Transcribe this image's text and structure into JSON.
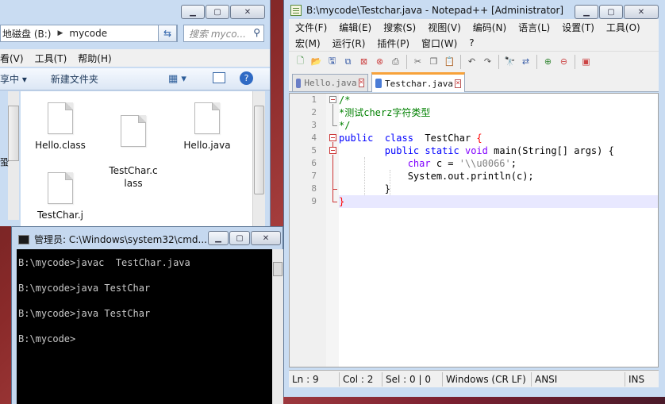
{
  "explorer": {
    "address": {
      "drive": "地磁盘 (B:)",
      "folder": "mycode"
    },
    "search_placeholder": "搜索 myco...",
    "menu": [
      "看(V)",
      "工具(T)",
      "帮助(H)"
    ],
    "toolbar": {
      "organize": "享中 ▾",
      "new_folder": "新建文件夹"
    },
    "files": [
      {
        "name": "Hello.class"
      },
      {
        "name": "TestChar.c\nlass"
      },
      {
        "name": "Hello.java"
      },
      {
        "name": "TestChar.j"
      }
    ],
    "side_text": "蛩"
  },
  "cmd": {
    "title": "管理员: C:\\Windows\\system32\\cmd....",
    "lines": [
      "B:\\mycode>javac  TestChar.java",
      "B:\\mycode>java TestChar",
      "B:\\mycode>java TestChar",
      "B:\\mycode>"
    ]
  },
  "npp": {
    "title": "B:\\mycode\\Testchar.java - Notepad++ [Administrator]",
    "menu_row1": [
      "文件(F)",
      "编辑(E)",
      "搜索(S)",
      "视图(V)",
      "编码(N)",
      "语言(L)",
      "设置(T)",
      "工具(O)"
    ],
    "menu_row2": [
      "宏(M)",
      "运行(R)",
      "插件(P)",
      "窗口(W)",
      "?"
    ],
    "tabs": [
      {
        "label": "Hello.java",
        "active": false
      },
      {
        "label": "Testchar.java",
        "active": true
      }
    ],
    "line_numbers": [
      "1",
      "2",
      "3",
      "4",
      "5",
      "6",
      "7",
      "8",
      "9"
    ],
    "status": {
      "ln": "Ln : 9",
      "col": "Col : 2",
      "sel": "Sel : 0 | 0",
      "eol": "Windows (CR LF)",
      "enc": "ANSI",
      "mode": "INS"
    }
  },
  "caption": {
    "min": "▁",
    "max": "▢",
    "close": "✕"
  },
  "colors": {
    "keyword": "#0000ff",
    "type": "#8000ff",
    "comment": "#008000",
    "string": "#808080",
    "brace": "#ff0000"
  }
}
